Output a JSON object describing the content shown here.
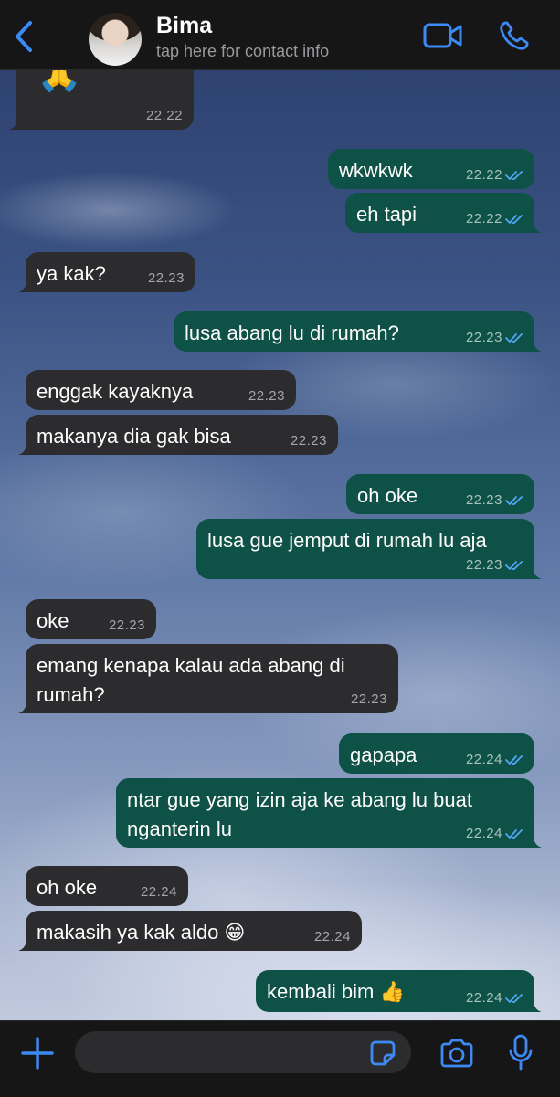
{
  "header": {
    "contact_name": "Bima",
    "contact_subtitle": "tap here for contact info",
    "icons": {
      "back": "chevron-left-icon",
      "video": "video-camera-icon",
      "call": "phone-icon"
    },
    "accent_color": "#3d8af7"
  },
  "messages": [
    {
      "dir": "in",
      "text": "🙏",
      "time": "22.22"
    },
    {
      "dir": "out",
      "text": "wkwkwk",
      "time": "22.22"
    },
    {
      "dir": "out",
      "text": "eh tapi",
      "time": "22.22"
    },
    {
      "dir": "in",
      "text": "ya kak?",
      "time": "22.23"
    },
    {
      "dir": "out",
      "text": "lusa abang lu di rumah?",
      "time": "22.23"
    },
    {
      "dir": "in",
      "text": "enggak kayaknya",
      "time": "22.23"
    },
    {
      "dir": "in",
      "text": "makanya dia gak bisa",
      "time": "22.23"
    },
    {
      "dir": "out",
      "text": "oh oke",
      "time": "22.23"
    },
    {
      "dir": "out",
      "text": "lusa gue jemput di rumah lu aja",
      "time": "22.23"
    },
    {
      "dir": "in",
      "text": "oke",
      "time": "22.23"
    },
    {
      "dir": "in",
      "text": "emang kenapa kalau ada abang di\nrumah?",
      "time": "22.23"
    },
    {
      "dir": "out",
      "text": "gapapa",
      "time": "22.24"
    },
    {
      "dir": "out",
      "text": "ntar gue yang izin aja ke abang lu buat\nnganterin lu",
      "time": "22.24"
    },
    {
      "dir": "in",
      "text": "oh oke",
      "time": "22.24"
    },
    {
      "dir": "in",
      "text": "makasih ya kak aldo 😁",
      "time": "22.24"
    },
    {
      "dir": "out",
      "text": "kembali bim 👍",
      "time": "22.24"
    }
  ],
  "composer": {
    "placeholder": "",
    "icons": {
      "attach": "plus-icon",
      "sticker": "sticker-icon",
      "camera": "camera-icon",
      "mic": "microphone-icon"
    }
  },
  "colors": {
    "incoming_bubble": "#2c2c2e",
    "outgoing_bubble": "#0e5247",
    "read_receipt": "#53a6f5"
  }
}
